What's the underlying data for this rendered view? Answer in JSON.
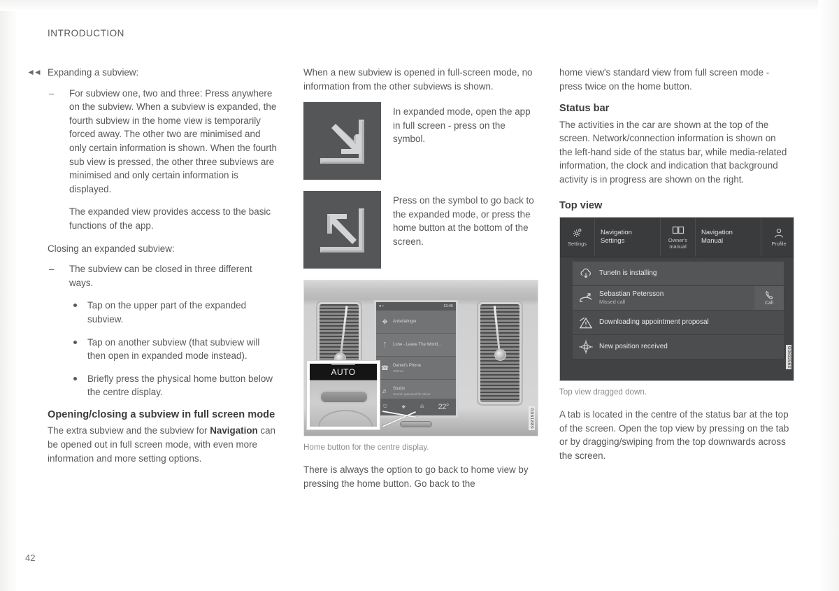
{
  "page": {
    "running_head": "INTRODUCTION",
    "folio": "42",
    "back_marker": "◄◄"
  },
  "col1": {
    "lead": "Expanding a subview:",
    "dash1_p1": "For subview one, two and three: Press anywhere on the subview. When a subview is expanded, the fourth subview in the home view is temporarily forced away. The other two are minimised and only certain information is shown. When the fourth sub view is pressed, the other three subviews are minimised and only certain information is displayed.",
    "dash1_p2": "The expanded view provides access to the basic functions of the app.",
    "closing_lead": "Closing an expanded subview:",
    "dash2_p1": "The subview can be closed in three different ways.",
    "bullets": [
      "Tap on the upper part of the expanded subview.",
      "Tap on another subview (that subview will then open in expanded mode instead).",
      "Briefly press the physical home button below the centre display."
    ],
    "heading_fullscreen": "Opening/closing a subview in full screen mode",
    "fullscreen_p_a": "The extra subview and the subview for ",
    "fullscreen_p_bold": "Navigation",
    "fullscreen_p_b": " can be opened out in full screen mode, with even more information and more setting options."
  },
  "col2": {
    "intro": "When a new subview is opened in full-screen mode, no information from the other subviews is shown.",
    "sym1": {
      "icon": "expand-to-fullscreen-icon",
      "caption": "In expanded mode, open the app in full screen - press on the symbol."
    },
    "sym2": {
      "icon": "collapse-from-fullscreen-icon",
      "caption": "Press on the symbol to go back to the expanded mode, or press the home button at the bottom of the screen."
    },
    "photo": {
      "caption": "Home button for the centre display.",
      "watermark": "G061889",
      "callout_label": "AUTO",
      "screen": {
        "clock": "13:45",
        "tiles": [
          {
            "icon": "navigation-compass-icon",
            "title": "Anbefalinger",
            "subtitle": ""
          },
          {
            "icon": "bluetooth-icon",
            "title": "Lune - Leave The World…",
            "subtitle": ""
          },
          {
            "icon": "phone-icon",
            "title": "Daniel's Phone",
            "subtitle": "Telenor"
          },
          {
            "icon": "sound-icon",
            "title": "Studio",
            "subtitle": "Sound optimised for driver"
          }
        ],
        "climate": {
          "temperature": "22°",
          "auto_label": "Auto"
        }
      }
    },
    "outro": "There is always the option to go back to home view by pressing the home button. Go back to the"
  },
  "col3": {
    "continuation": "home view's standard view from full screen mode - press twice on the home button.",
    "heading_statusbar": "Status bar",
    "statusbar_p": "The activities in the car are shown at the top of the screen. Network/connection information is shown on the left-hand side of the status bar, while media-related information, the clock and indication that background activity is in progress are shown on the right.",
    "heading_topview": "Top view",
    "topview": {
      "tabs": [
        {
          "type": "icon",
          "icon": "gear-icon",
          "label": "Settings"
        },
        {
          "type": "label",
          "label_line1": "Navigation",
          "label_line2": "Settings"
        },
        {
          "type": "icon",
          "icon": "book-icon",
          "label": "Owner's manual"
        },
        {
          "type": "label",
          "label_line1": "Navigation",
          "label_line2": "Manual"
        },
        {
          "type": "icon",
          "icon": "profile-icon",
          "label": "Profile"
        }
      ],
      "rows": [
        {
          "icon": "cloud-download-icon",
          "title": "TuneIn is installing",
          "subtitle": "",
          "action": ""
        },
        {
          "icon": "missed-call-icon",
          "title": "Sebastian Petersson",
          "subtitle": "Missed call",
          "action": "Call",
          "action_icon": "phone-icon"
        },
        {
          "icon": "calendar-warning-icon",
          "title": "Downloading appointment proposal",
          "subtitle": "",
          "action": ""
        },
        {
          "icon": "navigation-compass-icon",
          "title": "New position received",
          "subtitle": "",
          "action": ""
        }
      ],
      "watermark": "G0632563"
    },
    "topview_caption": "Top view dragged down.",
    "topview_p": "A tab is located in the centre of the status bar at the top of the screen. Open the top view by pressing on the tab or by dragging/swiping from the top downwards across the screen."
  }
}
